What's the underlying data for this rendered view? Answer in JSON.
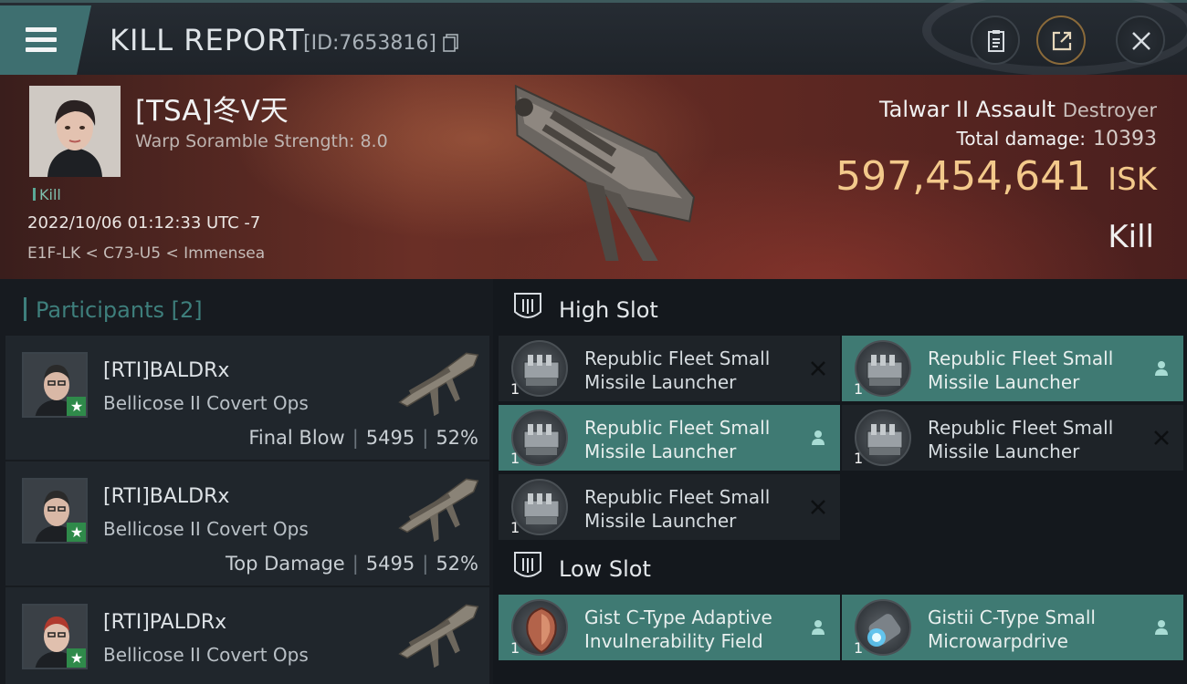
{
  "header": {
    "title": "KILL REPORT",
    "id_text": "[ID:7653816]"
  },
  "victim": {
    "name": "[TSA]冬V天",
    "scramble": "Warp Soramble Strength: 8.0",
    "tag": "Kill",
    "datetime": "2022/10/06 01:12:33 UTC -7",
    "location": "E1F-LK < C73-U5 < Immensea",
    "ship_name": "Talwar II Assault",
    "ship_class": "Destroyer",
    "total_damage_label": "Total damage:",
    "total_damage": "10393",
    "isk_value": "597,454,641",
    "isk_unit": "ISK",
    "kill_type": "Kill"
  },
  "participants": {
    "title": "Participants",
    "count": "[2]",
    "rows": [
      {
        "name": "[RTI]BALDRx",
        "ship": "Bellicose II Covert Ops",
        "role": "Final Blow",
        "damage": "5495",
        "percent": "52%"
      },
      {
        "name": "[RTI]BALDRx",
        "ship": "Bellicose II Covert Ops",
        "role": "Top Damage",
        "damage": "5495",
        "percent": "52%"
      },
      {
        "name": "[RTI]PALDRx",
        "ship": "Bellicose II Covert Ops"
      }
    ]
  },
  "slots": {
    "high_label": "High Slot",
    "high_items": [
      {
        "line1": "Republic Fleet Small",
        "line2": "Missile Launcher",
        "qty": "1",
        "status": "destroyed"
      },
      {
        "line1": "Republic Fleet Small",
        "line2": "Missile Launcher",
        "qty": "1",
        "status": "dropped"
      },
      {
        "line1": "Republic Fleet Small",
        "line2": "Missile Launcher",
        "qty": "1",
        "status": "dropped"
      },
      {
        "line1": "Republic Fleet Small",
        "line2": "Missile Launcher",
        "qty": "1",
        "status": "destroyed"
      },
      {
        "line1": "Republic Fleet Small",
        "line2": "Missile Launcher",
        "qty": "1",
        "status": "destroyed"
      }
    ],
    "low_label": "Low Slot",
    "low_items": [
      {
        "line1": "Gist C-Type Adaptive",
        "line2": "Invulnerability Field",
        "qty": "1",
        "status": "dropped"
      },
      {
        "line1": "Gistii C-Type Small",
        "line2": "Microwarpdrive",
        "qty": "1",
        "status": "dropped"
      }
    ]
  },
  "colors": {
    "accent": "#3f7a73",
    "isk": "#f3c98b",
    "participants_title": "#3e7f7c"
  },
  "icons": [
    "menu-icon",
    "copy-icon",
    "clipboard-icon",
    "share-icon",
    "close-icon",
    "slot-icon",
    "destroyed-icon",
    "dropped-icon",
    "star-icon"
  ]
}
